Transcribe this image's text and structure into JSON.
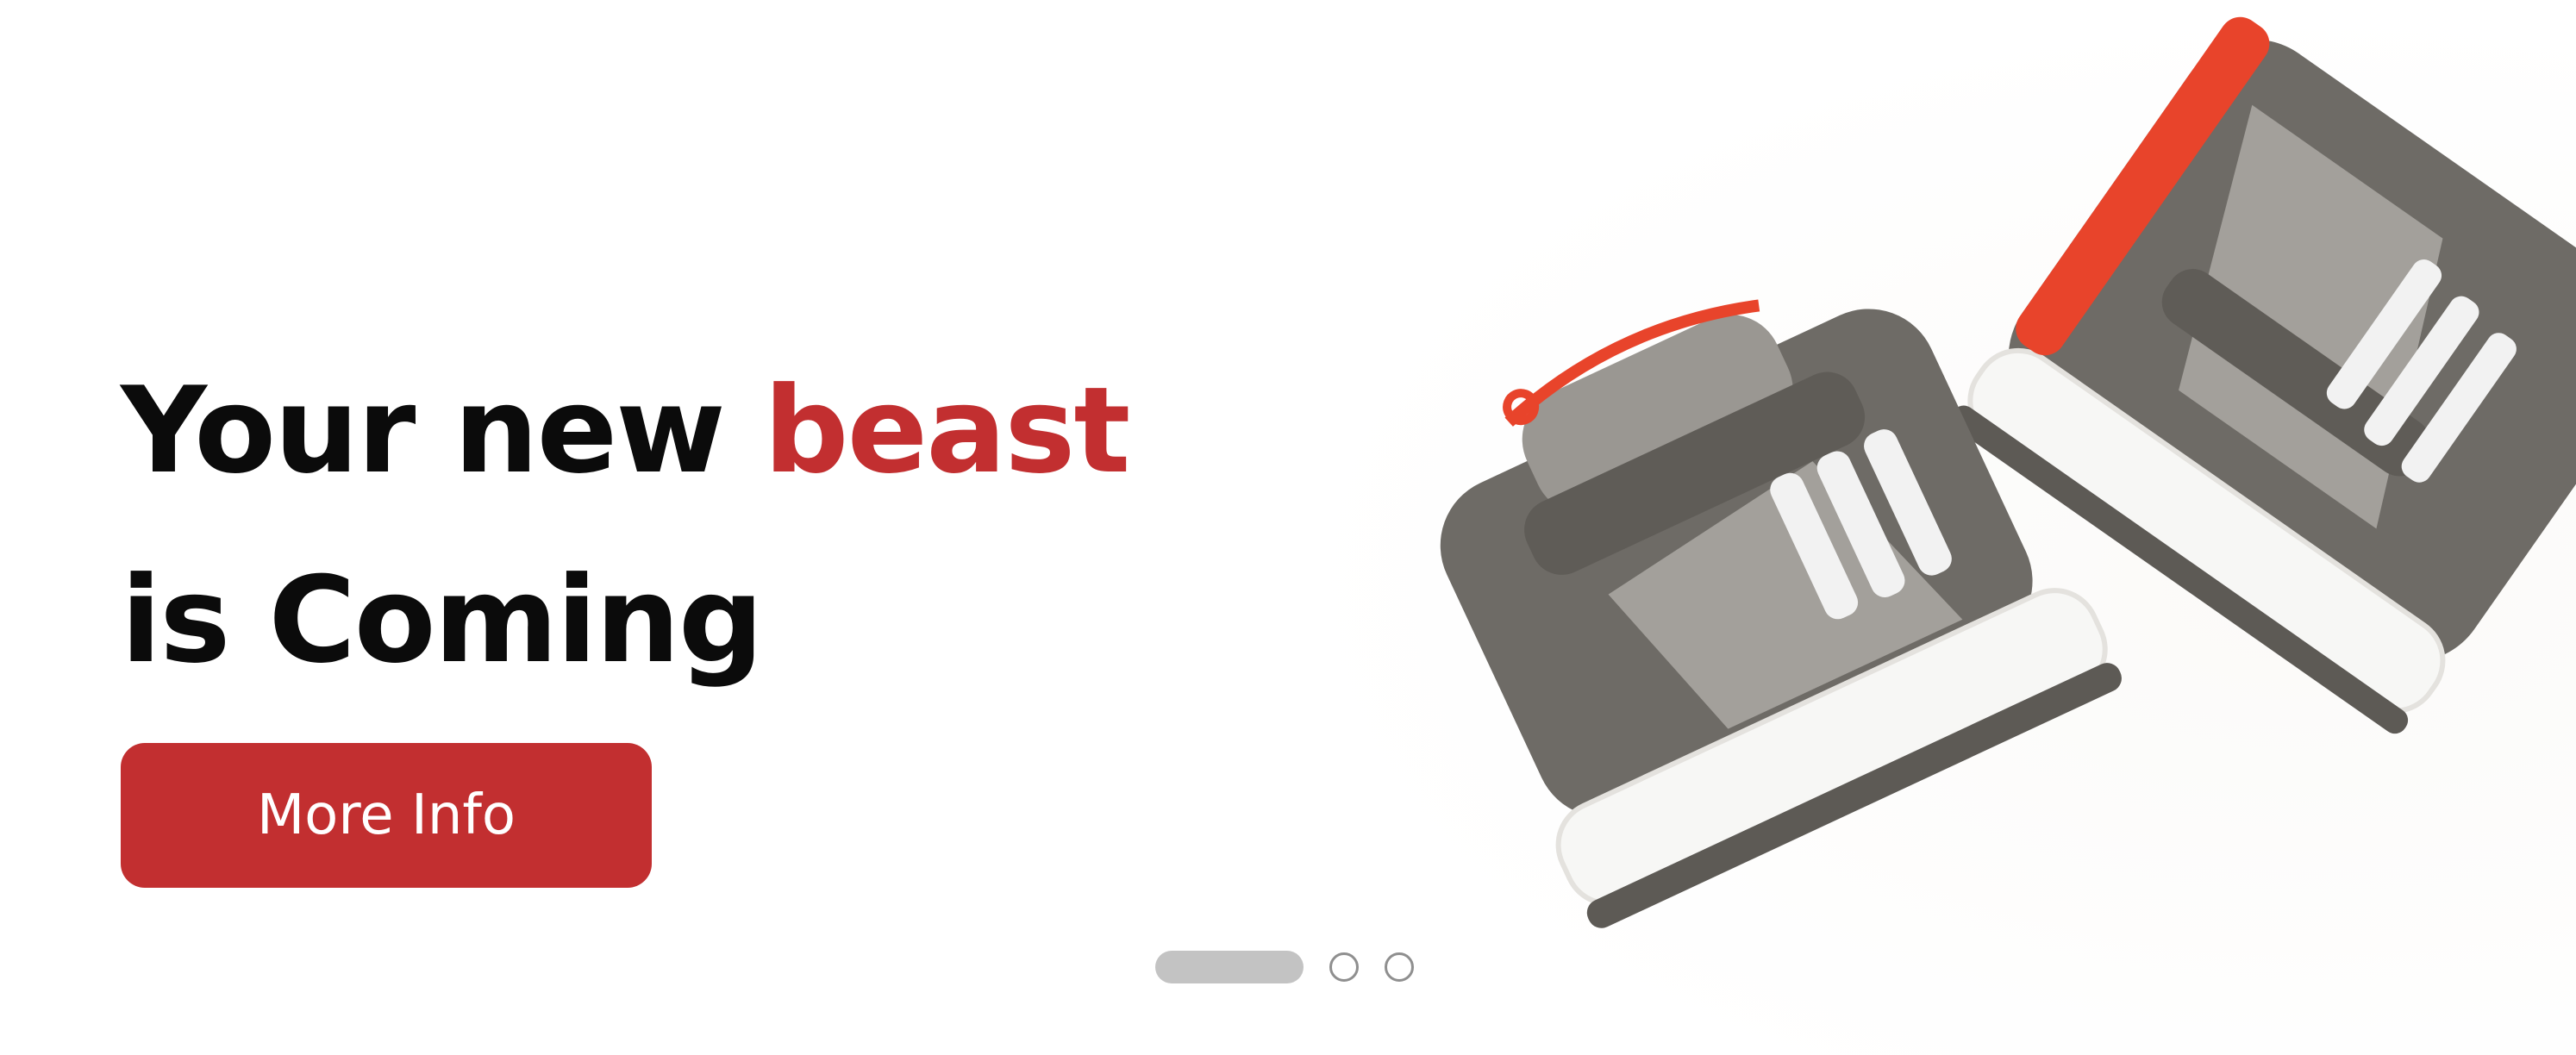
{
  "hero": {
    "headline_start": "Your new ",
    "headline_accent": "beast",
    "headline_line2": "is Coming",
    "cta_label": "More Info"
  },
  "carousel": {
    "slide_count": 3,
    "active_index": 0
  },
  "colors": {
    "accent": "#c22f30",
    "headline": "#0b0b0b",
    "button_text": "#ffffff",
    "dot_active": "#c3c3c3",
    "dot_border": "#8f8f8f",
    "shoe_suede": "#6e6b66",
    "shoe_glitter": "#a3a09b",
    "shoe_sole": "#f7f7f5",
    "shoe_trim": "#e8442b"
  },
  "icons": {
    "product_image": "sneakers-pair-image"
  }
}
